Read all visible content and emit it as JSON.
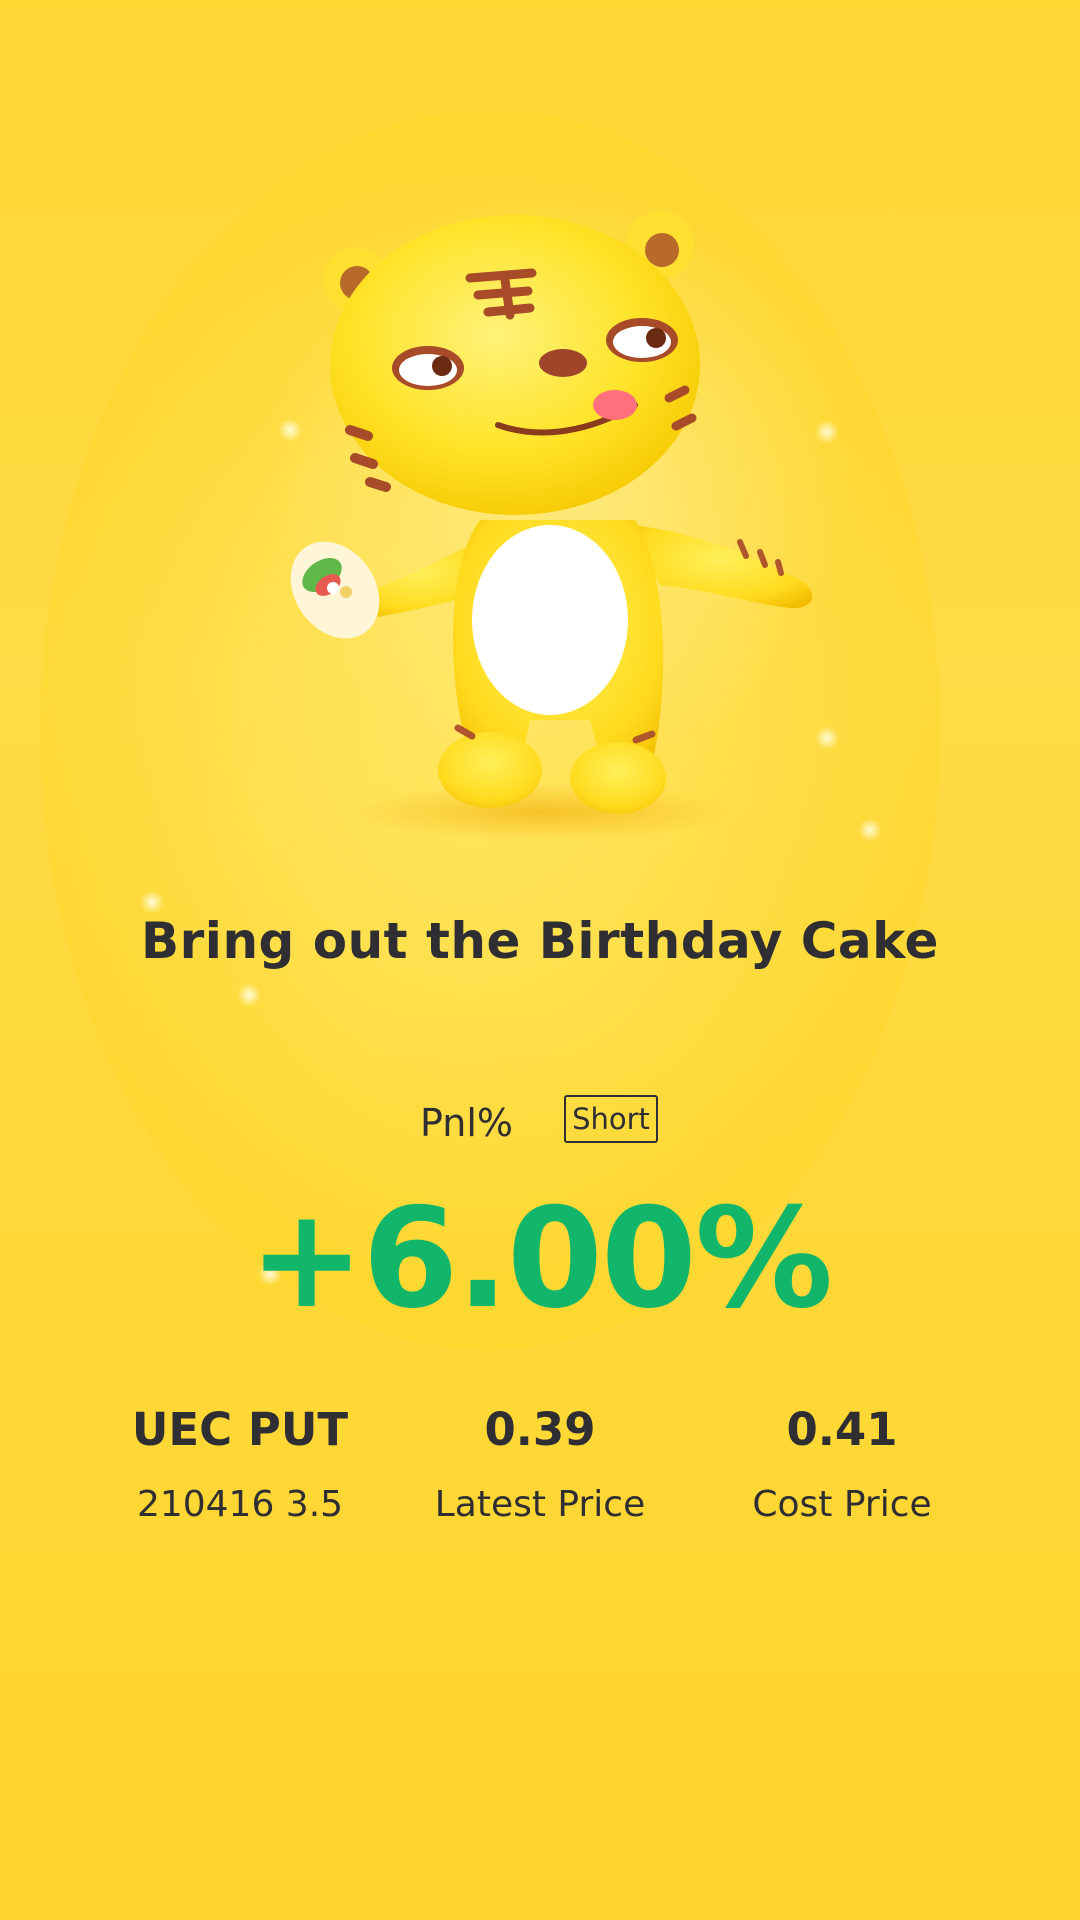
{
  "title": "Bring out the Birthday Cake",
  "pnl": {
    "label": "Pnl%",
    "direction_badge": "Short",
    "percent": "+6.00%",
    "percent_color": "#11b66a"
  },
  "stats": [
    {
      "value": "UEC PUT",
      "label": "210416 3.5"
    },
    {
      "value": "0.39",
      "label": "Latest Price"
    },
    {
      "value": "0.41",
      "label": "Cost Price"
    }
  ],
  "colors": {
    "background": "#ffd733",
    "text": "#2f2f33",
    "mascot_body": "#ffe030",
    "mascot_stripes": "#a0522d"
  },
  "mascot": {
    "icon": "tiger-mascot-holding-food"
  }
}
